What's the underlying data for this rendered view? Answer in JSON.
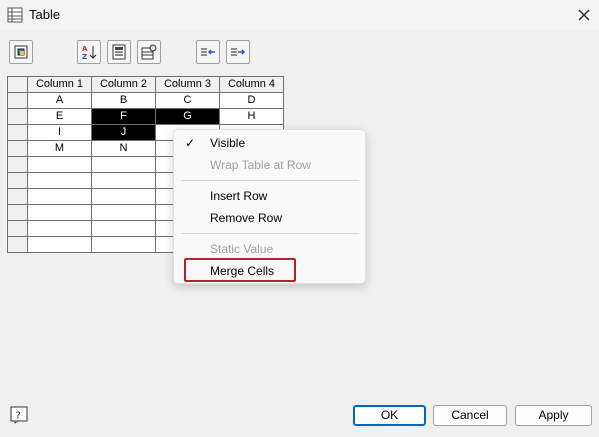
{
  "window": {
    "title": "Table",
    "icon": "table-icon",
    "close_icon": "close-icon"
  },
  "toolbar": {
    "buttons": [
      {
        "icon": "cell-properties-icon"
      },
      {
        "icon": "sort-az-icon"
      },
      {
        "icon": "table-data-icon"
      },
      {
        "icon": "table-properties-icon"
      },
      {
        "icon": "insert-column-left-icon"
      },
      {
        "icon": "insert-column-right-icon"
      }
    ]
  },
  "grid": {
    "columns": [
      "Column 1",
      "Column 2",
      "Column 3",
      "Column 4"
    ],
    "rows": [
      [
        "A",
        "B",
        "C",
        "D"
      ],
      [
        "E",
        "F",
        "G",
        "H"
      ],
      [
        "I",
        "J",
        "",
        ""
      ],
      [
        "M",
        "N",
        "",
        ""
      ],
      [
        "",
        "",
        "",
        ""
      ],
      [
        "",
        "",
        "",
        ""
      ],
      [
        "",
        "",
        "",
        ""
      ],
      [
        "",
        "",
        "",
        ""
      ],
      [
        "",
        "",
        "",
        ""
      ],
      [
        "",
        "",
        "",
        ""
      ]
    ],
    "selected_cells": [
      "F",
      "G",
      "J"
    ]
  },
  "context_menu": {
    "items": [
      {
        "label": "Visible",
        "checked": true,
        "enabled": true
      },
      {
        "label": "Wrap Table at Row",
        "enabled": false
      },
      {
        "label": "Insert Row",
        "enabled": true
      },
      {
        "label": "Remove Row",
        "enabled": true
      },
      {
        "label": "Static Value",
        "enabled": false
      },
      {
        "label": "Merge Cells",
        "enabled": true,
        "highlighted": true
      }
    ],
    "check_mark": "✓"
  },
  "footer": {
    "help_icon": "help-icon",
    "ok_label": "OK",
    "cancel_label": "Cancel",
    "apply_label": "Apply"
  },
  "colors": {
    "highlight_border": "#b3252b",
    "default_button_border": "#0067c0",
    "selection": "#000000"
  }
}
